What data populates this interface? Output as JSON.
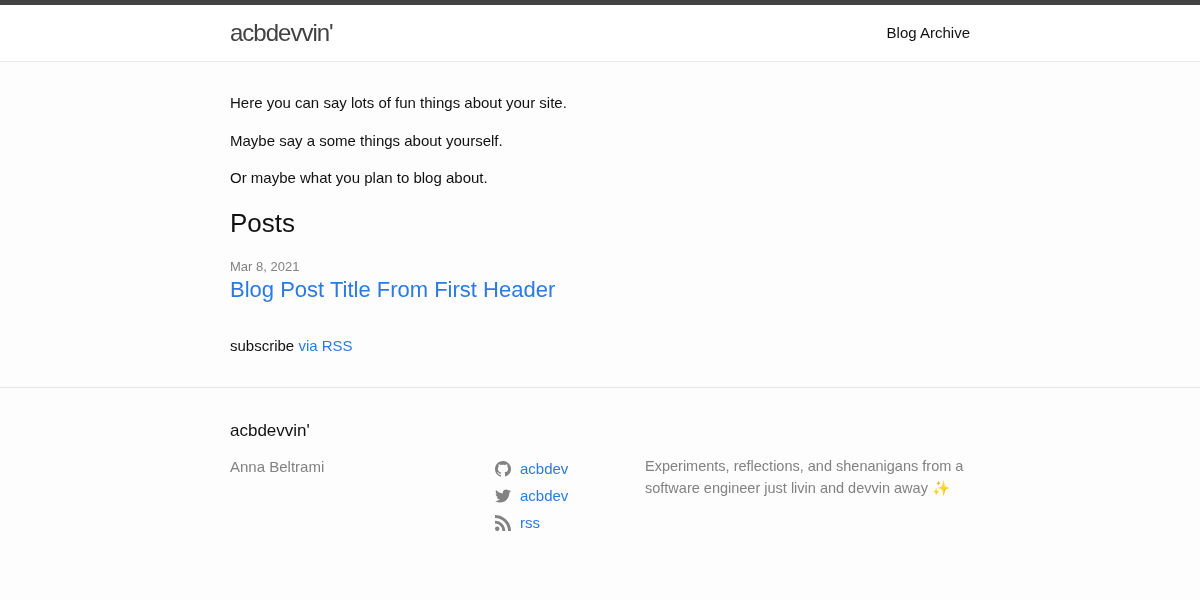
{
  "header": {
    "site_title": "acbdevvin'",
    "nav": [
      "Blog Archive"
    ]
  },
  "intro": [
    "Here you can say lots of fun things about your site.",
    "Maybe say a some things about yourself.",
    "Or maybe what you plan to blog about."
  ],
  "posts": {
    "heading": "Posts",
    "items": [
      {
        "date": "Mar 8, 2021",
        "title": "Blog Post Title From First Header"
      }
    ]
  },
  "subscribe": {
    "text": "subscribe",
    "link": "via RSS"
  },
  "footer": {
    "title": "acbdevvin'",
    "author": "Anna Beltrami",
    "links": [
      {
        "kind": "github",
        "label": "acbdev"
      },
      {
        "kind": "twitter",
        "label": "acbdev"
      },
      {
        "kind": "rss",
        "label": "rss"
      }
    ],
    "description": "Experiments, reflections, and shenanigans from a software engineer just livin and devvin away ✨"
  }
}
